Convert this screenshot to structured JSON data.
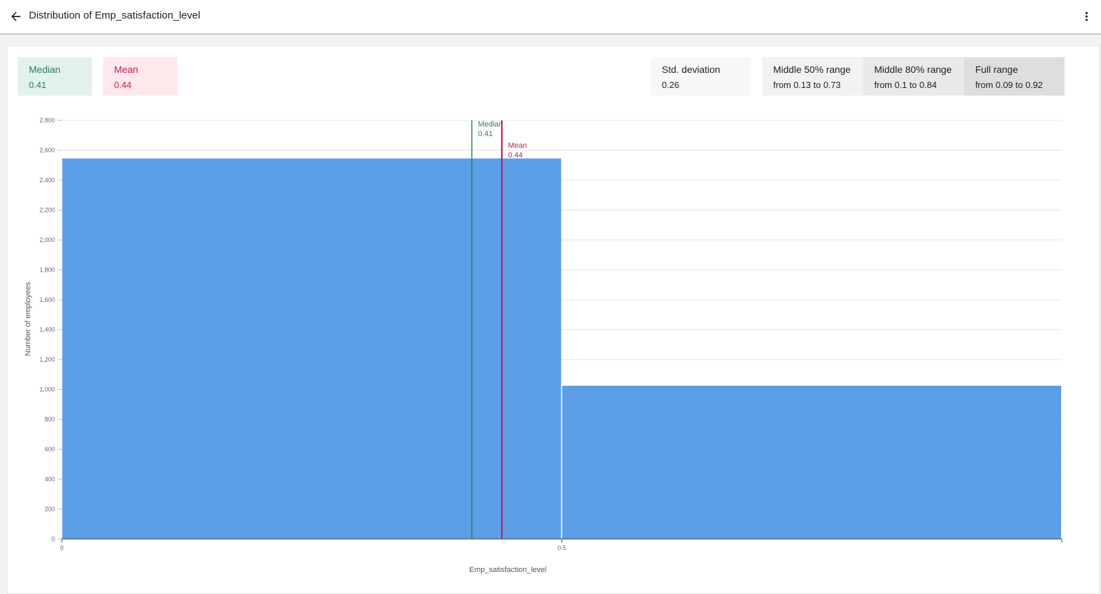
{
  "header": {
    "title": "Distribution of Emp_satisfaction_level"
  },
  "stats": {
    "median": {
      "label": "Median",
      "value": "0.41"
    },
    "mean": {
      "label": "Mean",
      "value": "0.44"
    },
    "std": {
      "label": "Std. deviation",
      "value": "0.26"
    },
    "mid50": {
      "label": "Middle 50% range",
      "value": "from 0.13 to 0.73"
    },
    "mid80": {
      "label": "Middle 80% range",
      "value": "from 0.1 to 0.84"
    },
    "full": {
      "label": "Full range",
      "value": "from 0.09 to 0.92"
    }
  },
  "colors": {
    "bar": "#5c9ee6",
    "median": "#2e7d4f",
    "mean": "#c2185b",
    "median_bg": "#e3f1ee",
    "mean_bg": "#fde8ec"
  },
  "chart_data": {
    "type": "bar",
    "xlabel": "Emp_satisfaction_level",
    "ylabel": "Number of employees",
    "xlim": [
      0,
      1
    ],
    "ylim": [
      0,
      2800
    ],
    "x_ticks": [
      0,
      0.5
    ],
    "x_tick_labels": [
      "0",
      "0.5"
    ],
    "y_ticks": [
      0,
      200,
      400,
      600,
      800,
      1000,
      1200,
      1400,
      1600,
      1800,
      2000,
      2200,
      2400,
      2600,
      2800
    ],
    "y_tick_labels": [
      "0",
      "200",
      "400",
      "600",
      "800",
      "1,000",
      "1,200",
      "1,400",
      "1,600",
      "1,800",
      "2,000",
      "2,200",
      "2,400",
      "2,600",
      "2,800"
    ],
    "bins": [
      {
        "from": 0,
        "to": 0.5,
        "count": 2545
      },
      {
        "from": 0.5,
        "to": 1,
        "count": 1025
      }
    ],
    "reference_lines": [
      {
        "name": "Median",
        "value": 0.41,
        "label": "0.41"
      },
      {
        "name": "Mean",
        "value": 0.44,
        "label": "0.44"
      }
    ],
    "grid": true
  }
}
